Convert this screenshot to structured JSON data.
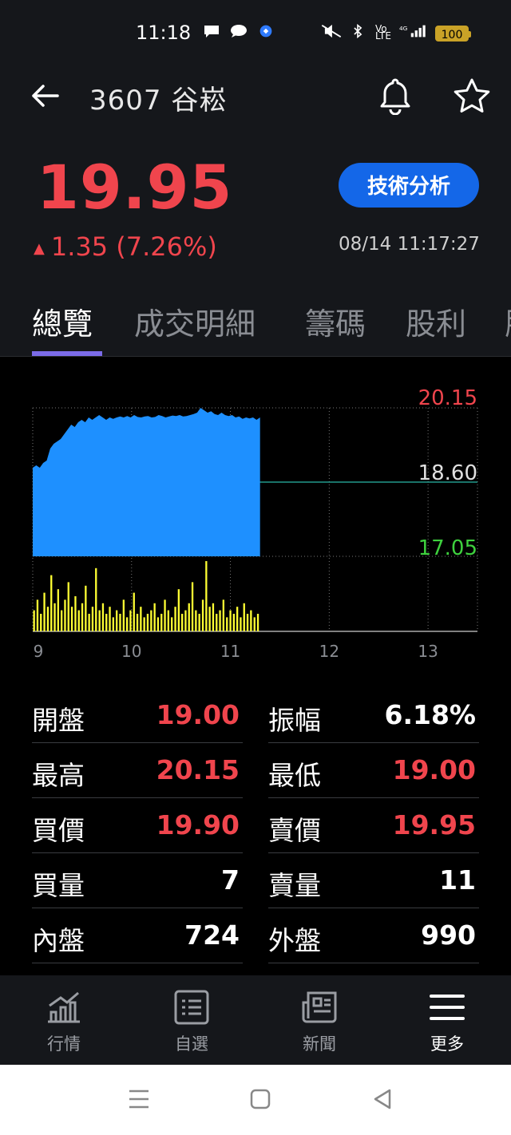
{
  "status_bar": {
    "time": "11:18",
    "battery": "100"
  },
  "header": {
    "title": "3607 谷崧"
  },
  "quote": {
    "price": "19.95",
    "change": "1.35 (7.26%)",
    "datetime": "08/14 11:17:27",
    "tech_button": "技術分析",
    "up_color": "#f0454d"
  },
  "tabs": [
    "總覽",
    "成交明細",
    "籌碼",
    "股利",
    "股"
  ],
  "chart_data": {
    "type": "area",
    "x_ticks": [
      "9",
      "10",
      "11",
      "12",
      "13"
    ],
    "y_labels": {
      "high": "20.15",
      "ref": "18.60",
      "low": "17.05"
    },
    "ylim": [
      17.05,
      20.15
    ],
    "price_series": [
      18.9,
      18.95,
      18.9,
      19.0,
      19.05,
      19.3,
      19.4,
      19.45,
      19.5,
      19.6,
      19.7,
      19.8,
      19.75,
      19.85,
      19.9,
      19.85,
      19.95,
      19.9,
      19.95,
      20.0,
      19.95,
      19.9,
      19.95,
      19.92,
      19.95,
      19.97,
      19.95,
      19.98,
      19.95,
      20.0,
      19.96,
      19.95,
      19.97,
      19.98,
      19.95,
      19.96,
      20.0,
      19.98,
      19.95,
      19.97,
      19.99,
      19.98,
      20.0,
      19.97,
      19.98,
      20.0,
      20.02,
      20.05,
      20.15,
      20.1,
      20.05,
      20.08,
      20.02,
      20.0,
      20.05,
      20.0,
      19.98,
      20.0,
      19.95,
      19.97,
      19.92,
      19.95,
      19.93,
      19.95,
      19.9,
      19.95
    ],
    "volume_series": [
      30,
      45,
      25,
      55,
      35,
      80,
      40,
      60,
      30,
      45,
      70,
      35,
      50,
      30,
      40,
      65,
      25,
      35,
      90,
      30,
      40,
      25,
      35,
      20,
      30,
      25,
      45,
      20,
      30,
      55,
      25,
      35,
      20,
      25,
      30,
      40,
      20,
      25,
      45,
      30,
      20,
      35,
      60,
      25,
      30,
      40,
      70,
      30,
      25,
      45,
      100,
      35,
      40,
      25,
      30,
      45,
      20,
      30,
      25,
      35,
      20,
      40,
      25,
      30,
      20,
      25
    ],
    "area_color": "#1e90ff",
    "volume_color": "#ffff33"
  },
  "stats": [
    {
      "label": "開盤",
      "value": "19.00",
      "color": "red"
    },
    {
      "label": "振幅",
      "value": "6.18%",
      "color": "white"
    },
    {
      "label": "最高",
      "value": "20.15",
      "color": "red"
    },
    {
      "label": "最低",
      "value": "19.00",
      "color": "red"
    },
    {
      "label": "買價",
      "value": "19.90",
      "color": "red"
    },
    {
      "label": "賣價",
      "value": "19.95",
      "color": "red"
    },
    {
      "label": "買量",
      "value": "7",
      "color": "white"
    },
    {
      "label": "賣量",
      "value": "11",
      "color": "white"
    },
    {
      "label": "內盤",
      "value": "724",
      "color": "white"
    },
    {
      "label": "外盤",
      "value": "990",
      "color": "white"
    }
  ],
  "bottom_nav": [
    {
      "label": "行情",
      "icon": "chart-icon"
    },
    {
      "label": "自選",
      "icon": "list-icon"
    },
    {
      "label": "新聞",
      "icon": "news-icon"
    },
    {
      "label": "更多",
      "icon": "menu-icon"
    }
  ]
}
